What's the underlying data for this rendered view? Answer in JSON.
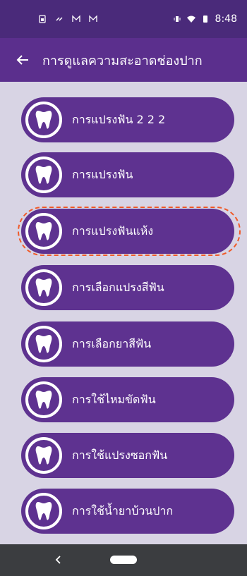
{
  "status_bar": {
    "time": "8:48"
  },
  "app_bar": {
    "title": "การดูแลความสะอาดช่องปาก"
  },
  "items": [
    {
      "label": "การแปรงฟัน 2 2 2"
    },
    {
      "label": "การแปรงฟัน"
    },
    {
      "label": "การแปรงฟันแห้ง"
    },
    {
      "label": "การเลือกแปรงสีฟัน"
    },
    {
      "label": "การเลือกยาสีฟัน"
    },
    {
      "label": "การใช้ไหมขัดฟัน"
    },
    {
      "label": "การใช้แปรงซอกฟัน"
    },
    {
      "label": "การใช้น้ำยาบ้วนปาก"
    }
  ],
  "colors": {
    "accent": "#5e3290",
    "highlight": "#f05a28"
  }
}
